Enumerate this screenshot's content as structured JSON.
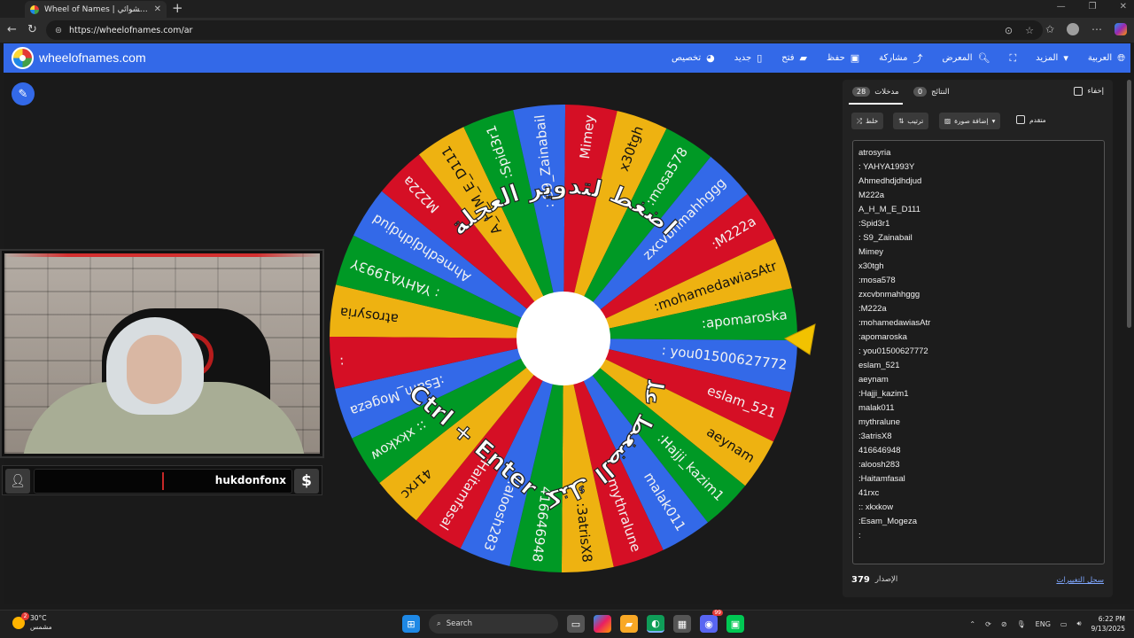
{
  "browser": {
    "tab_title": "Wheel of Names | الاسم العشوائي",
    "url": "https://wheelofnames.com/ar"
  },
  "header": {
    "brand": "wheelofnames.com",
    "menu": [
      {
        "label": "العربية",
        "icon": "globe-icon"
      },
      {
        "label": "المزيد",
        "icon": "chevron-down-icon"
      },
      {
        "label": "",
        "icon": "fullscreen-icon"
      },
      {
        "label": "المعرض",
        "icon": "search-icon"
      },
      {
        "label": "مشاركة",
        "icon": "share-icon"
      },
      {
        "label": "حفظ",
        "icon": "save-icon"
      },
      {
        "label": "فتح",
        "icon": "folder-icon"
      },
      {
        "label": "جديد",
        "icon": "file-icon"
      },
      {
        "label": "تخصيص",
        "icon": "palette-icon"
      }
    ]
  },
  "wheel": {
    "entries": [
      "atrosyria",
      ": YAHYA1993Y",
      "Ahmedhdjdhdjud",
      "M222a",
      "A_H_M_E_D111",
      ":Spid3r1",
      ": S9_Zainabail",
      "Mimey",
      "x30tgh",
      ":mosa578",
      "zxcvbnmahhggg",
      ":M222a",
      ":mohamedawiasAtr",
      ":apomaroska",
      ": you01500627772",
      "eslam_521",
      "aeynam",
      ":Hajji_kazim1",
      "malak011",
      "mythralune",
      ":3atrisX8",
      "416646948",
      ":aloosh283",
      ":Haitamfasal",
      "41rxc",
      ":: xkxkow",
      ":Esam_Mogeza",
      ":"
    ],
    "colors": [
      "#3369e8",
      "#d50f25",
      "#eeb211",
      "#009925"
    ],
    "spin_text_top": "اضغط لتدوير العجلة",
    "spin_text_bottom": "أو يمكنك الضغط على زر",
    "shortcut_text": "Ctrl + Enter"
  },
  "panel": {
    "tab_entries_label": "مدخلات",
    "tab_entries_count": "28",
    "tab_results_label": "النتائج",
    "tab_results_count": "0",
    "hide_label": "إخفاء",
    "shuffle_label": "خلط",
    "sort_label": "ترتيب",
    "add_image_label": "إضافة صورة",
    "advanced_label": "متقدم",
    "entries_text": [
      "atrosyria",
      ": YAHYA1993Y",
      "Ahmedhdjdhdjud",
      "M222a",
      "A_H_M_E_D111",
      ":Spid3r1",
      ": S9_Zainabail",
      "Mimey",
      "x30tgh",
      ":mosa578",
      "zxcvbnmahhggg",
      ":M222a",
      ":mohamedawiasAtr",
      ":apomaroska",
      ": you01500627772",
      "eslam_521",
      "aeynam",
      ":Hajji_kazim1",
      "malak011",
      "mythralune",
      ":3atrisX8",
      "416646948",
      ":aloosh283",
      ":Haitamfasal",
      "41rxc",
      ":: xkxkow",
      ":Esam_Mogeza",
      ":"
    ],
    "version_label": "الإصدار",
    "version_number": "379",
    "changelog_label": "سجل التغييرات"
  },
  "overlay": {
    "streamer_name": "hukdonfonx",
    "dollar": "$"
  },
  "taskbar": {
    "temperature": "30°C",
    "weather": "مشمس",
    "weather_badge": "2",
    "search_placeholder": "Search",
    "lang": "ENG",
    "time": "6:22 PM",
    "date": "9/13/2025",
    "notif_badge": "99"
  }
}
